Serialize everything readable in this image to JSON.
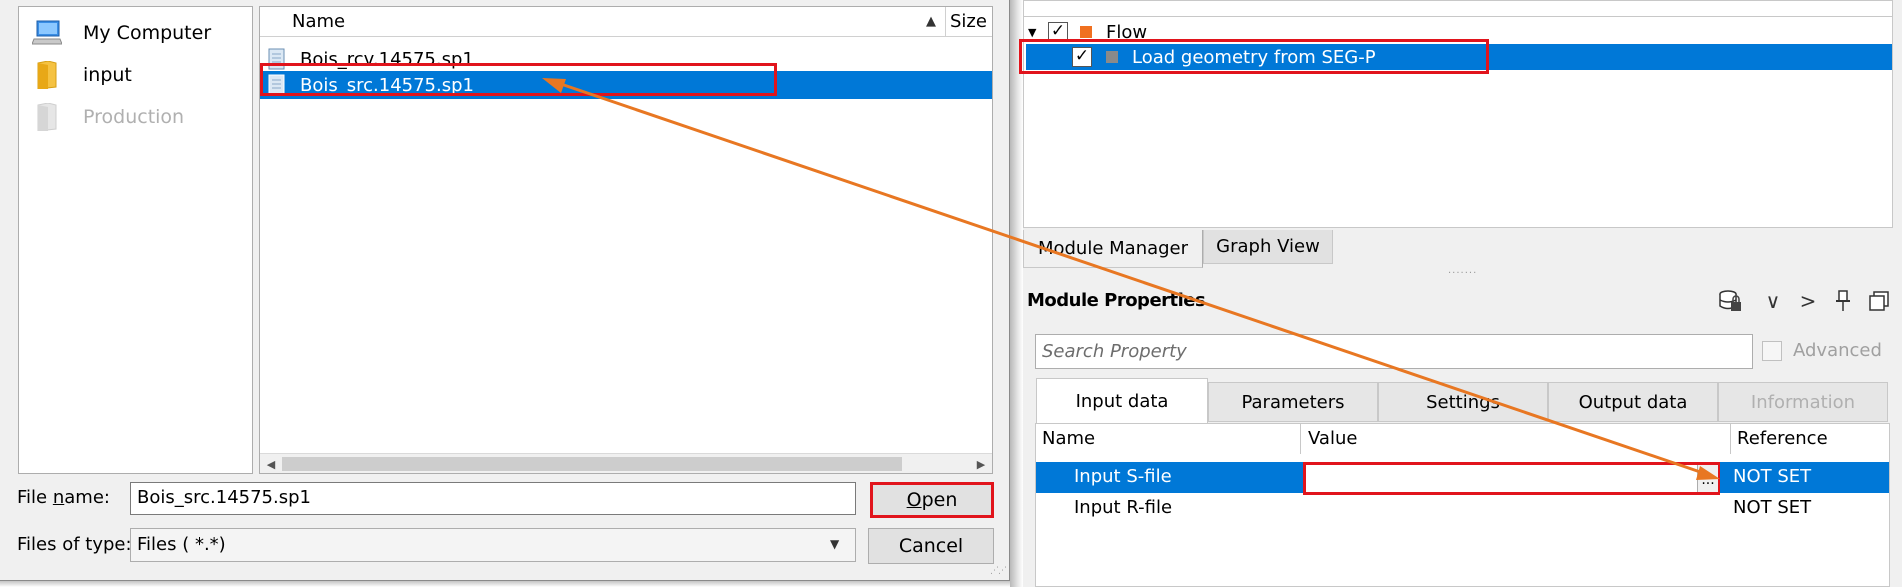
{
  "file_dialog": {
    "places": [
      {
        "label": "My Computer",
        "icon": "computer-icon",
        "enabled": true
      },
      {
        "label": "input",
        "icon": "folder-icon",
        "enabled": true
      },
      {
        "label": "Production",
        "icon": "folder-icon",
        "enabled": false
      }
    ],
    "columns": {
      "name": "Name",
      "size": "Size"
    },
    "files": [
      {
        "name": "Bois_rcv.14575.sp1",
        "selected": false
      },
      {
        "name": "Bois_src.14575.sp1",
        "selected": true
      }
    ],
    "file_name_label": "File name:",
    "file_name_value": "Bois_src.14575.sp1",
    "files_of_type_label": "Files of type:",
    "files_of_type_value": "Files ( *.*)",
    "open_label": "Open",
    "cancel_label": "Cancel"
  },
  "flow_tree": {
    "root": {
      "label": "Flow",
      "checked": true,
      "color": "#f07020"
    },
    "child": {
      "label": "Load geometry from SEG-P",
      "checked": true,
      "color": "#808080",
      "selected": true
    }
  },
  "bottom_tabs": [
    {
      "label": "Module Manager",
      "active": true
    },
    {
      "label": "Graph View",
      "active": false
    }
  ],
  "module_properties": {
    "title": "Module Properties",
    "toolbar_icons": [
      "database-lock-icon",
      "chevron-down-icon",
      "chevron-right-icon",
      "pin-icon",
      "restore-icon"
    ],
    "toolbar_glyphs": {
      "chevron_down": "∨",
      "chevron_right": ">"
    },
    "search_placeholder": "Search Property",
    "advanced_label": "Advanced",
    "tabs": [
      {
        "label": "Input data",
        "active": true,
        "enabled": true
      },
      {
        "label": "Parameters",
        "active": false,
        "enabled": true
      },
      {
        "label": "Settings",
        "active": false,
        "enabled": true
      },
      {
        "label": "Output data",
        "active": false,
        "enabled": true
      },
      {
        "label": "Information",
        "active": false,
        "enabled": false
      }
    ],
    "table": {
      "headers": {
        "name": "Name",
        "value": "Value",
        "reference": "Reference"
      },
      "rows": [
        {
          "name": "Input S-file",
          "value": "",
          "reference": "NOT SET",
          "selected": true
        },
        {
          "name": "Input R-file",
          "value": "",
          "reference": "NOT SET",
          "selected": false
        }
      ],
      "browse_label": "..."
    }
  },
  "colors": {
    "selection": "#0078d7",
    "highlight": "#e1141c",
    "annotation_arrow": "#e87722"
  }
}
